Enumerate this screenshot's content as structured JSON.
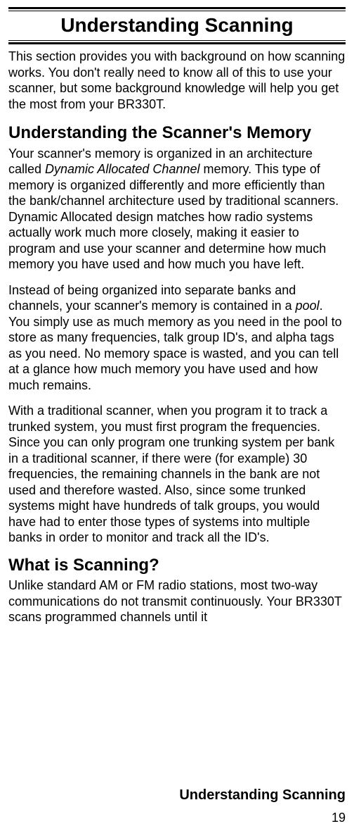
{
  "title": "Understanding Scanning",
  "intro": "This section provides you with background on how scanning works. You don't really need to know all of this to use your scanner, but some background knowledge will help you get the most from your BR330T.",
  "section1": {
    "heading": "Understanding the Scanner's Memory",
    "p1a": "Your scanner's memory is organized in an architecture called ",
    "p1_em": "Dynamic Allocated Channel",
    "p1b": " memory. This type of memory is organized differently and more efficiently than the bank/channel architecture used by traditional scanners. Dynamic Allocated design matches how radio systems actually work much more closely, making it easier to program and use your scanner and determine how much memory you have used and how much you have left.",
    "p2a": "Instead of being organized into separate banks and channels, your scanner's memory is contained in a ",
    "p2_em": "pool",
    "p2b": ". You simply use as much memory as you need in the pool to store as many frequencies, talk group ID's, and alpha tags as you need. No memory space is wasted, and you can tell at a glance how much memory you have used and how much remains.",
    "p3": "With a traditional scanner, when you program it to track a trunked system, you must first program the frequencies. Since you can only program one trunking system per bank in a traditional scanner, if there were (for example) 30 frequencies, the remaining channels in the bank are not used and therefore wasted. Also, since some trunked systems might have hundreds of talk groups, you would have had to enter those types of systems into multiple banks in order to monitor and track all the ID's."
  },
  "section2": {
    "heading": "What is Scanning?",
    "p1": "Unlike standard AM or FM radio stations, most two-way communications do not transmit continuously. Your BR330T scans programmed channels until it"
  },
  "footerLabel": "Understanding Scanning",
  "pageNumber": "19"
}
